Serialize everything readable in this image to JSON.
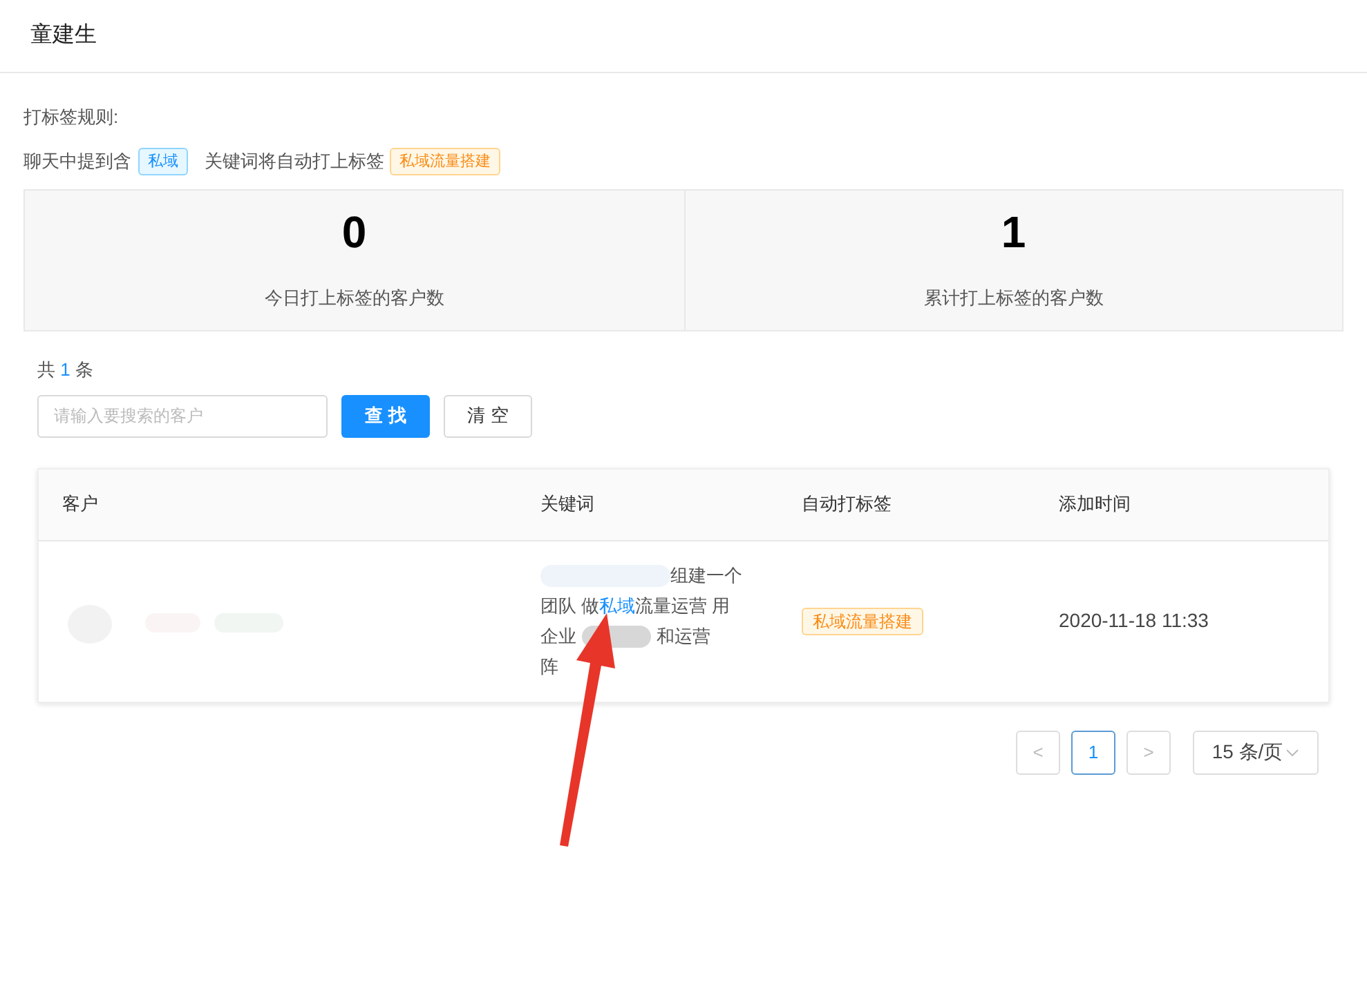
{
  "title": "童建生",
  "rule": {
    "label": "打标签规则:",
    "prefix": "聊天中提到含",
    "keyword_tag": "私域",
    "middle": "关键词将自动打上标签",
    "auto_tag": "私域流量搭建"
  },
  "stats": [
    {
      "value": "0",
      "label": "今日打上标签的客户数"
    },
    {
      "value": "1",
      "label": "累计打上标签的客户数"
    }
  ],
  "count": {
    "prefix": "共",
    "number": "1",
    "suffix": "条"
  },
  "search": {
    "placeholder": "请输入要搜索的客户"
  },
  "buttons": [
    {
      "label": "查 找",
      "kind": "primary"
    },
    {
      "label": "清 空",
      "kind": "default"
    }
  ],
  "table": {
    "columns": [
      "客户",
      "关键词",
      "自动打标签",
      "添加时间"
    ],
    "rows": [
      {
        "keyword_lines": [
          [
            {
              "text": "组建一个",
              "kind": "plain",
              "redacted_before": true
            }
          ],
          [
            {
              "text": "团队 做",
              "kind": "plain"
            },
            {
              "text": "私域",
              "kind": "highlight"
            },
            {
              "text": "流量运营 用",
              "kind": "plain"
            }
          ],
          [
            {
              "text": "企业",
              "kind": "plain"
            },
            {
              "text": "和运营",
              "kind": "plain",
              "redacted_before": true
            }
          ],
          [
            {
              "text": "阵",
              "kind": "plain"
            }
          ]
        ],
        "tag": "私域流量搭建",
        "time": "2020-11-18 11:33"
      }
    ]
  },
  "pagination": {
    "prev": "<",
    "pages": [
      {
        "label": "1",
        "selected": true
      }
    ],
    "next": ">",
    "page_size": "15 条/页"
  }
}
